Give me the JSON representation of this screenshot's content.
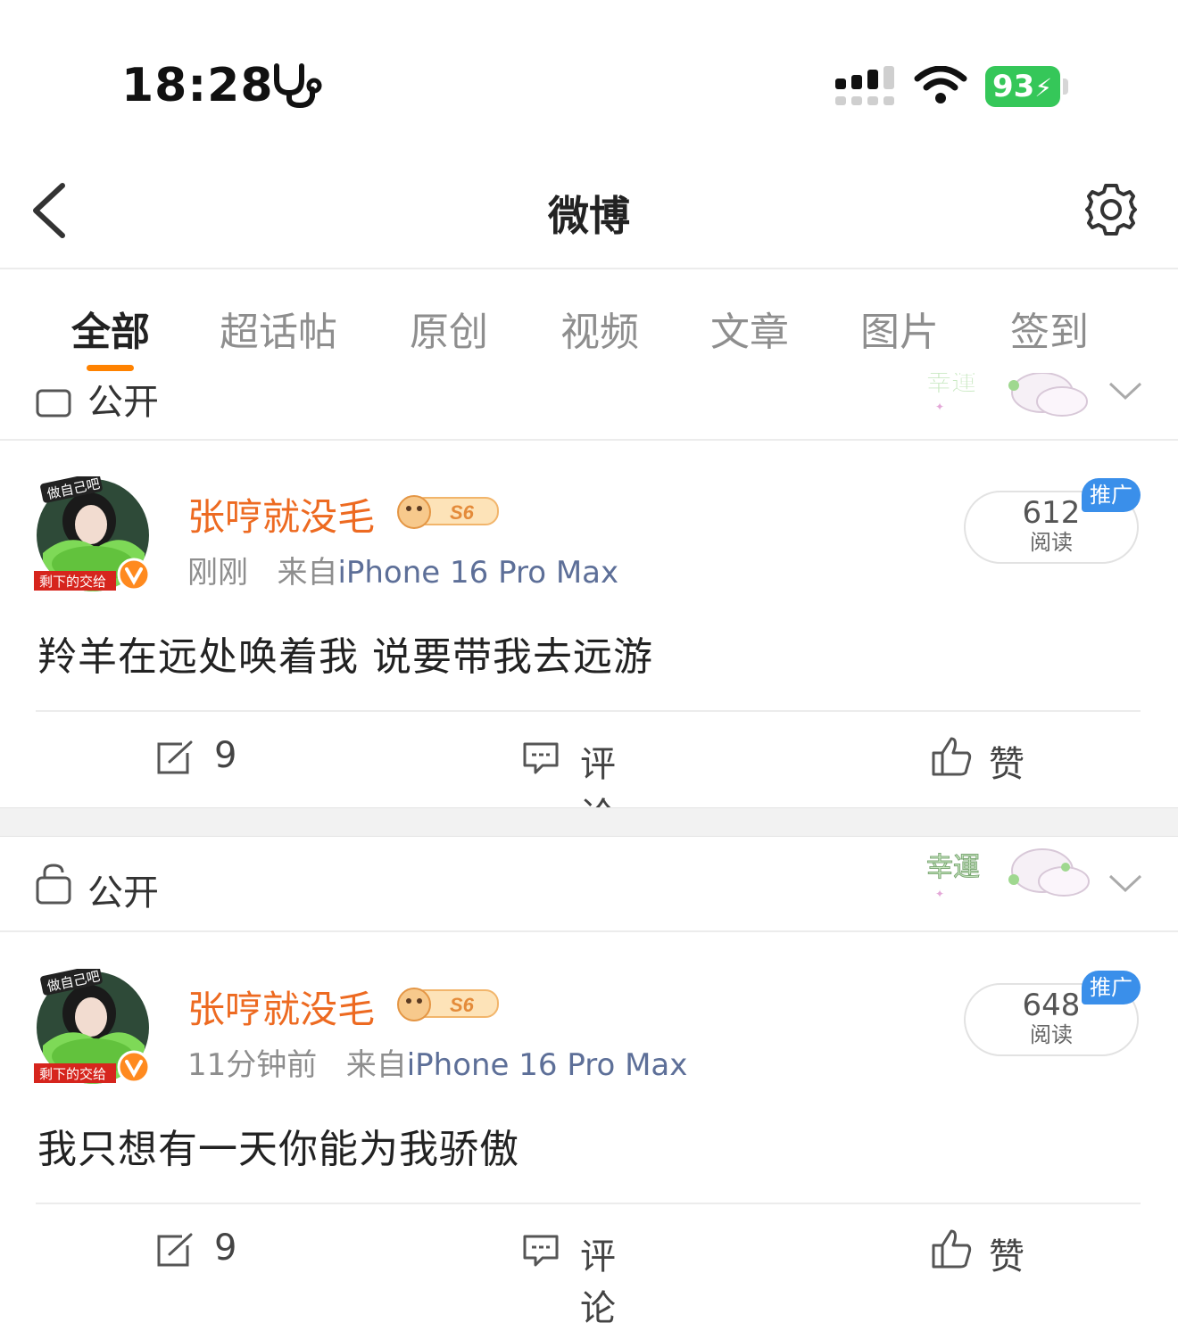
{
  "status_bar": {
    "time": "18:28",
    "battery": "93"
  },
  "nav": {
    "title": "微博"
  },
  "tabs": [
    "全部",
    "超话帖",
    "原创",
    "视频",
    "文章",
    "图片",
    "签到"
  ],
  "visibility_label": "公开",
  "posts": [
    {
      "username": "张哼就没毛",
      "time": "刚刚",
      "source_prefix": "来自",
      "source": "iPhone 16 Pro Max",
      "read_count": "612",
      "read_label": "阅读",
      "promo_label": "推广",
      "text": "羚羊在远处唤着我 说要带我去远游",
      "repost_count": "9",
      "comment_label": "评论",
      "like_label": "赞"
    },
    {
      "username": "张哼就没毛",
      "time": "11分钟前",
      "source_prefix": "来自",
      "source": "iPhone 16 Pro Max",
      "read_count": "648",
      "read_label": "阅读",
      "promo_label": "推广",
      "text": "我只想有一天你能为我骄傲",
      "repost_count": "9",
      "comment_label": "评论",
      "like_label": "赞"
    }
  ],
  "avatar": {
    "top_label": "做自己吧",
    "bottom_label": "剩下的交给"
  },
  "badge_label": "S6",
  "sticker_label": "幸運",
  "colors": {
    "accent": "#ff8200",
    "username": "#ed6a21",
    "source": "#5d6f98",
    "promo": "#3a8fea",
    "battery": "#35c759"
  }
}
